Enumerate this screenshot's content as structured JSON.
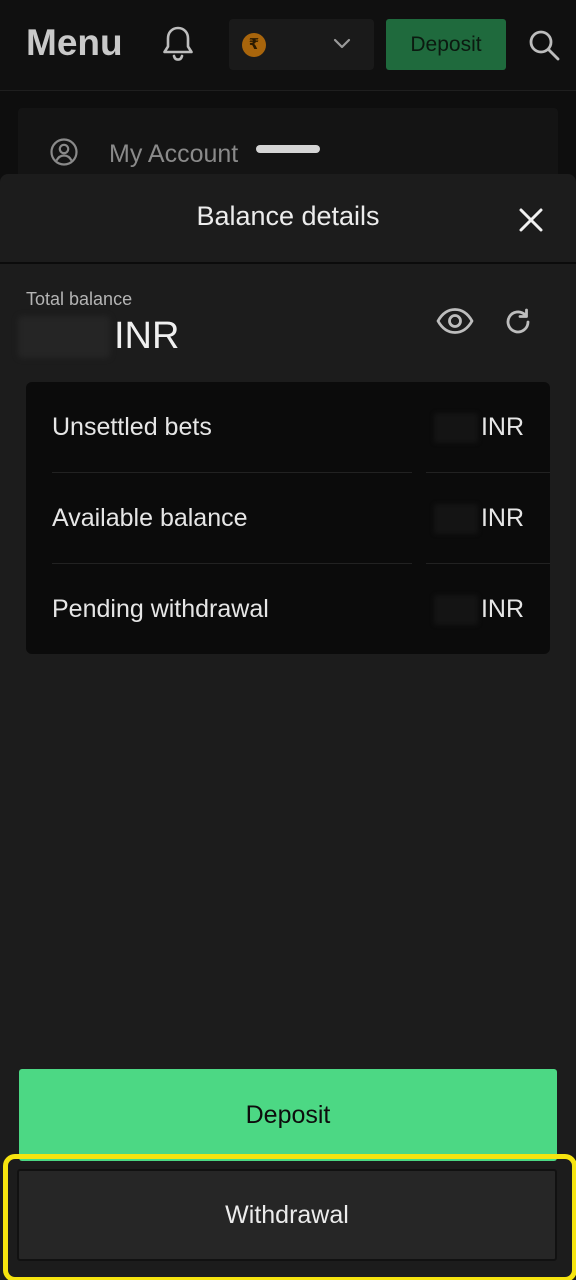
{
  "header": {
    "title": "Menu",
    "currency_symbol": "₹",
    "deposit_label": "Deposit",
    "icons": {
      "notifications": "bell-icon",
      "dropdown": "chevron-down-icon",
      "search": "search-icon"
    }
  },
  "menu": {
    "my_account_label": "My Account"
  },
  "sheet": {
    "title": "Balance details",
    "total_label": "Total balance",
    "total_currency": "INR",
    "rows": [
      {
        "label": "Unsettled bets",
        "currency": "INR"
      },
      {
        "label": "Available balance",
        "currency": "INR"
      },
      {
        "label": "Pending withdrawal",
        "currency": "INR"
      }
    ],
    "deposit_label": "Deposit",
    "withdrawal_label": "Withdrawal"
  },
  "colors": {
    "accent_green": "#4cd884",
    "highlight_yellow": "#f6e40f",
    "background": "#1c1c1c"
  }
}
